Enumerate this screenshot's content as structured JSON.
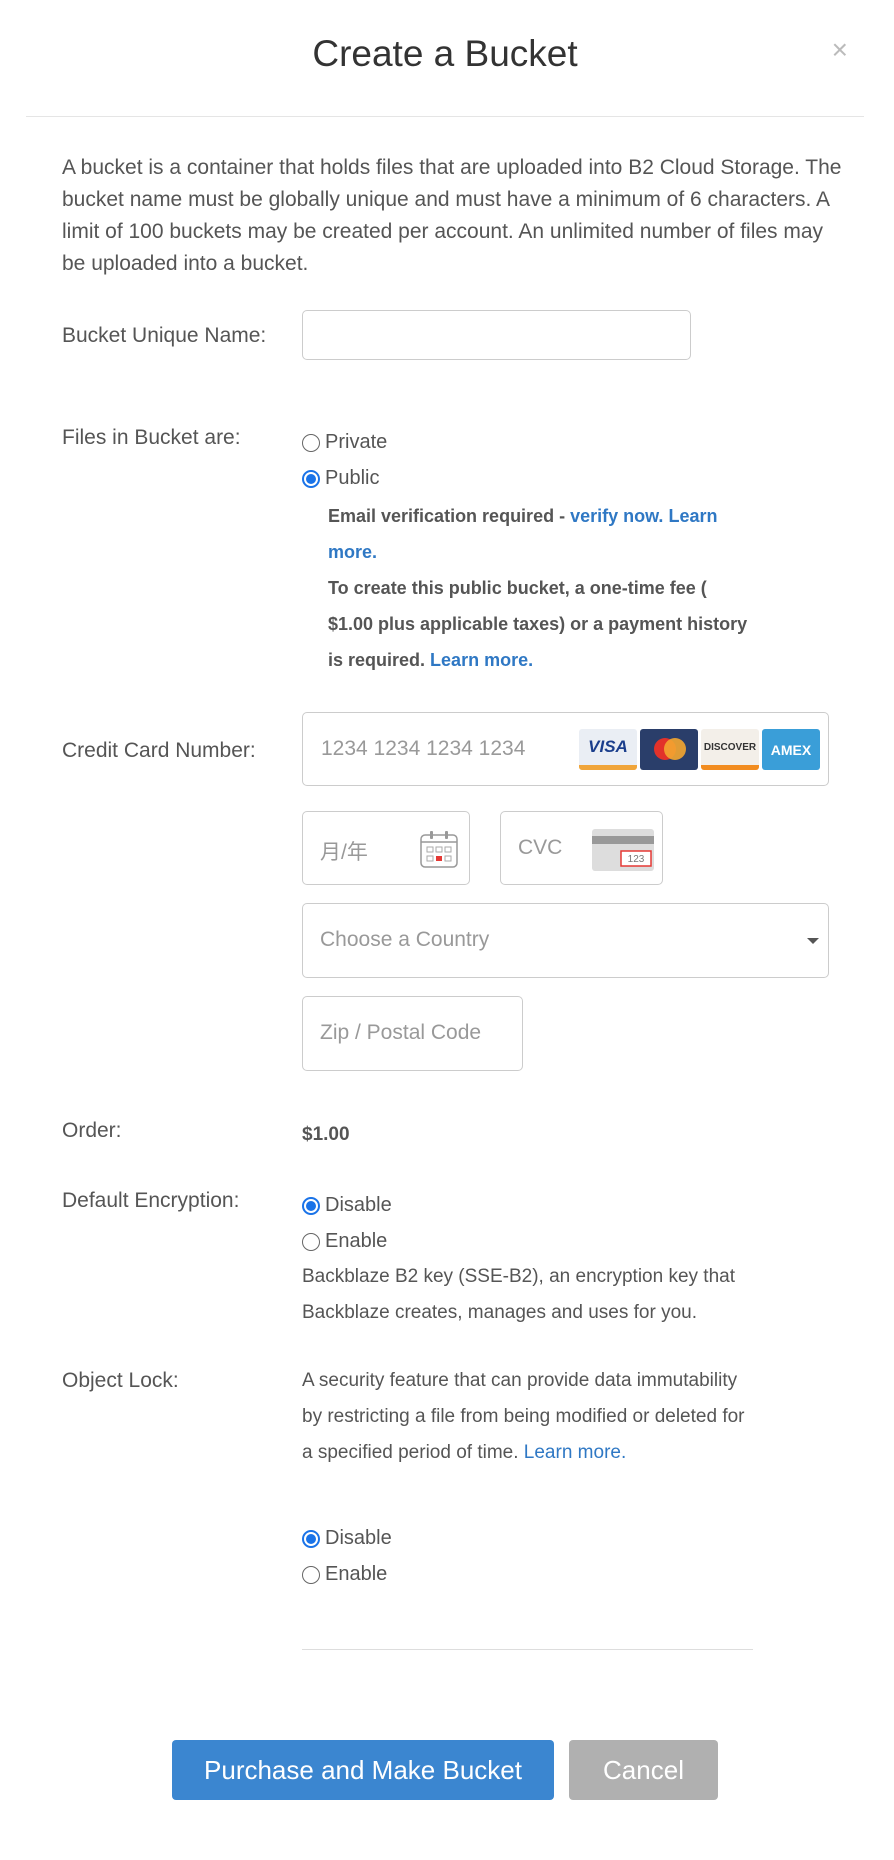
{
  "modal": {
    "title": "Create a Bucket",
    "close_glyph": "×",
    "intro": "A bucket is a container that holds files that are uploaded into B2 Cloud Storage. The bucket name must be globally unique and must have a minimum of 6 characters. A limit of 100 buckets may be created per account. An unlimited number of files may be uploaded into a bucket."
  },
  "bucket_name": {
    "label": "Bucket Unique Name:",
    "value": "",
    "placeholder": ""
  },
  "visibility": {
    "label": "Files in Bucket are:",
    "options": [
      {
        "label": "Private",
        "checked": false
      },
      {
        "label": "Public",
        "checked": true
      }
    ],
    "notice": {
      "email_text": "Email verification required - ",
      "verify_link": "verify now.",
      "learn_more_1": "Learn more.",
      "fee_text": "To create this public bucket, a one-time fee ( $1.00 plus applicable taxes) or a payment history is required.",
      "learn_more_2": "Learn more."
    }
  },
  "payment": {
    "label": "Credit Card Number:",
    "card_placeholder": "1234 1234 1234 1234",
    "card_brands": [
      "VISA",
      "MasterCard",
      "DISCOVER",
      "AMEX"
    ],
    "expiry_placeholder": "月/年",
    "cvc_placeholder": "CVC",
    "cvc_icon_text": "123",
    "country_placeholder": "Choose a Country",
    "zip_placeholder": "Zip / Postal Code"
  },
  "order": {
    "label": "Order:",
    "value": "$1.00"
  },
  "encryption": {
    "label": "Default Encryption:",
    "options": [
      {
        "label": "Disable",
        "checked": true
      },
      {
        "label": "Enable",
        "checked": false
      }
    ],
    "help": "Backblaze B2 key (SSE-B2), an encryption key that Backblaze creates, manages and uses for you."
  },
  "object_lock": {
    "label": "Object Lock:",
    "help": "A security feature that can provide data immutability by restricting a file from being modified or deleted for a specified period of time.",
    "learn_more": "Learn more.",
    "options": [
      {
        "label": "Disable",
        "checked": true
      },
      {
        "label": "Enable",
        "checked": false
      }
    ]
  },
  "actions": {
    "primary_label": "Purchase and Make Bucket",
    "cancel_label": "Cancel"
  },
  "colors": {
    "primary": "#3b86d0",
    "link": "#2f78c4",
    "radio_checked": "#1a73e8",
    "cancel": "#b0b0b0"
  }
}
